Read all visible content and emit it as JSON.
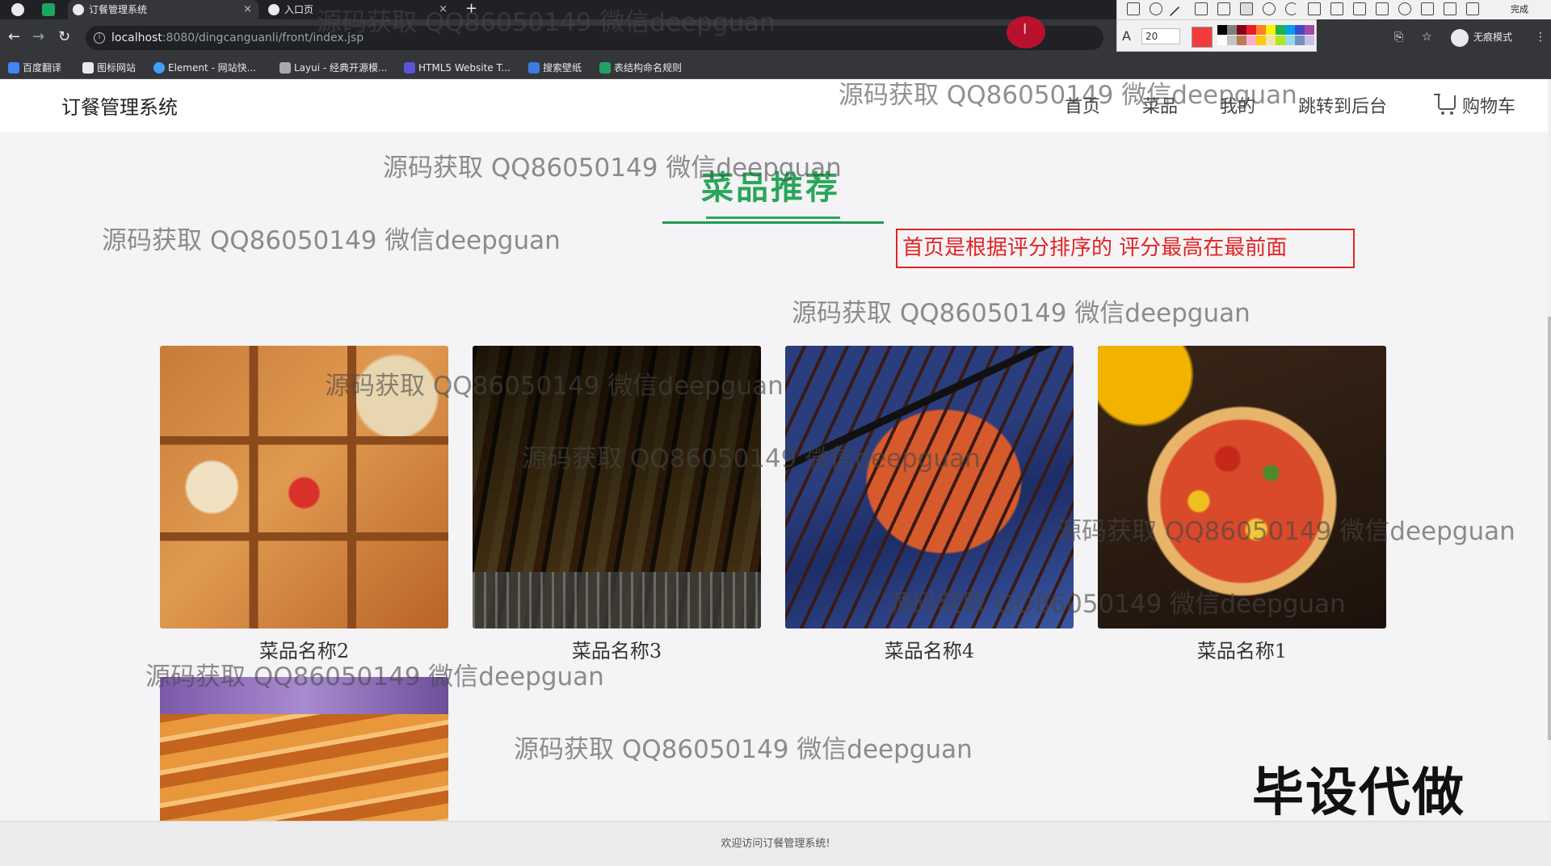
{
  "browser": {
    "tabs": [
      {
        "label": "订餐管理系统",
        "active": true
      },
      {
        "label": "入口页",
        "active": false
      }
    ],
    "new_tab": "+",
    "close_glyph": "×",
    "address_host": "localhost",
    "address_path": ":8080/dingcanguanli/front/index.jsp",
    "profile_label": "无痕模式",
    "bookmarks": [
      "百度翻译",
      "图标网站",
      "Element - 网站快...",
      "Layui - 经典开源模...",
      "HTML5 Website T...",
      "搜索壁纸",
      "表结构命名规则"
    ]
  },
  "snip_tool": {
    "font_glyph": "A",
    "font_size": "20",
    "done_label": "完成",
    "active_color": "#f03c3c",
    "palette": [
      "#000000",
      "#7f7f7f",
      "#880015",
      "#ed1c24",
      "#ff7f27",
      "#fff200",
      "#22b14c",
      "#00a2e8",
      "#3f48cc",
      "#a349a4",
      "#ffffff",
      "#c3c3c3",
      "#b97a57",
      "#ffaec9",
      "#ffc90e",
      "#efe4b0",
      "#b5e61d",
      "#99d9ea",
      "#7092be",
      "#c8bfe7"
    ]
  },
  "header": {
    "logo": "订餐管理系统",
    "nav": [
      "首页",
      "菜品",
      "我的",
      "跳转到后台",
      "购物车"
    ]
  },
  "section": {
    "title": "菜品推荐",
    "annotation": "首页是根据评分排序的  评分最高在最前面"
  },
  "dishes": [
    {
      "name": "菜品名称2"
    },
    {
      "name": "菜品名称3"
    },
    {
      "name": "菜品名称4"
    },
    {
      "name": "菜品名称1"
    }
  ],
  "overlay_text": "毕设代做",
  "watermark": "源码获取 QQ86050149 微信deepguan",
  "footer": "欢迎访问订餐管理系统!",
  "colors": {
    "accent": "#2aa65a",
    "annotation": "#e02424"
  }
}
